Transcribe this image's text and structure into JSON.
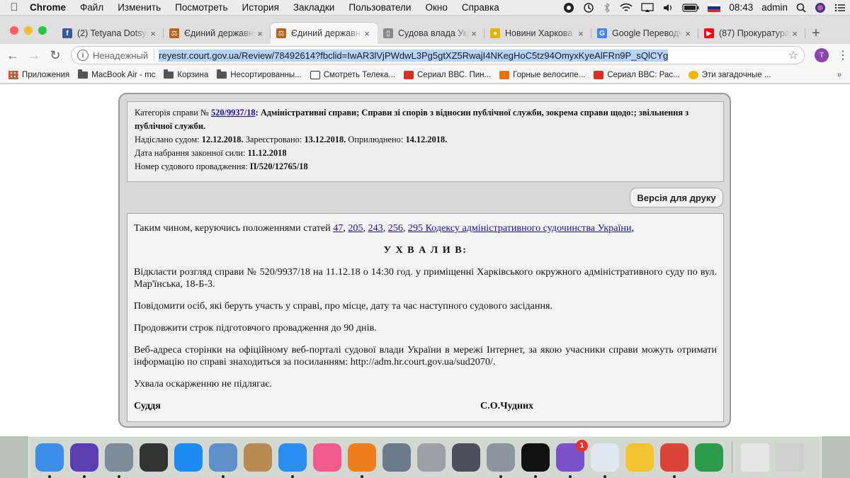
{
  "menubar": {
    "app": "Chrome",
    "items": [
      "Файл",
      "Изменить",
      "Посмотреть",
      "История",
      "Закладки",
      "Пользователи",
      "Окно",
      "Справка"
    ],
    "time": "08:43",
    "user": "admin"
  },
  "tabs": [
    {
      "title": "(2) Tetyana Dotsyak",
      "icon": "facebook-icon",
      "color": "#3b5998",
      "glyph": "f"
    },
    {
      "title": "Єдиний державний",
      "icon": "gavel-icon",
      "color": "#b5651d",
      "glyph": "⚖"
    },
    {
      "title": "Єдиний державний",
      "icon": "gavel-icon",
      "color": "#b5651d",
      "glyph": "⚖",
      "active": true
    },
    {
      "title": "Судова влада України",
      "icon": "page-icon",
      "color": "#888888",
      "glyph": "▯"
    },
    {
      "title": "Новини Харкова",
      "icon": "news-icon",
      "color": "#e8b400",
      "glyph": "●"
    },
    {
      "title": "Google Переводчик",
      "icon": "translate-icon",
      "color": "#4285f4",
      "glyph": "G"
    },
    {
      "title": "(87) Прокуратура",
      "icon": "youtube-icon",
      "color": "#ff0000",
      "glyph": "▶"
    }
  ],
  "toolbar": {
    "security": "Ненадежный",
    "url": "reyestr.court.gov.ua/Review/78492614?fbclid=IwAR3lVjPWdwL3Pg5gtXZ5RwajI4NKegHoC5tz94OmyxKyeAlFRn9P_sQlCYg",
    "profile_initial": "T"
  },
  "bookmarks": [
    {
      "label": "Приложения",
      "icon": "apps-grid-icon"
    },
    {
      "label": "MacBook Air - mc",
      "icon": "folder-icon"
    },
    {
      "label": "Корзина",
      "icon": "folder-icon"
    },
    {
      "label": "Несортированны...",
      "icon": "folder-icon"
    },
    {
      "label": "Смотреть Телека...",
      "icon": "tv-icon"
    },
    {
      "label": "Сериал ВВС. Пин...",
      "icon": "bookmark-red-icon"
    },
    {
      "label": "Горные велосипе...",
      "icon": "bookmark-orange-icon"
    },
    {
      "label": "Сериал ВВС: Рас...",
      "icon": "bookmark-red-icon"
    },
    {
      "label": "Эти загадочные ...",
      "icon": "bookmark-yellow-icon"
    }
  ],
  "meta": {
    "category_label": "Категорія справи №",
    "case_no": "520/9937/18",
    "category_text": ": Адміністративні справи; Справи зі спорів з відносин публічної служби, зокрема справи щодо:; звільнення з публічної служби.",
    "sent_label": "Надіслано судом:",
    "sent": "12.12.2018.",
    "reg_label": "Зареєстровано:",
    "reg": "13.12.2018.",
    "pub_label": "Оприлюднено:",
    "pub": "14.12.2018.",
    "force_label": "Дата набрання законної сили:",
    "force": "11.12.2018",
    "proc_label": "Номер судового провадження:",
    "proc": "П/520/12765/18"
  },
  "print_button": "Версія для друку",
  "doc": {
    "intro": "Таким чином, керуючись положеннями статей",
    "articles": [
      "47",
      "205",
      "243",
      "256"
    ],
    "code_link": "295 Кодексу адміністративного судочинства України",
    "resolved": "У Х В А Л И В:",
    "p1": "Відкласти розгляд справи № 520/9937/18 на 11.12.18 о 14:30 год. у приміщенні Харківського окружного адміністративного суду по вул. Мар'їнська, 18-Б-3.",
    "p2": "Повідомити осіб, які беруть участь у справі, про місце, дату та час наступного судового засідання.",
    "p3": "Продовжити строк підготовчого провадження до 90 днів.",
    "p4": "Веб-адреса сторінки на офіційному веб-порталі судової влади України в мережі Інтернет, за якою учасники справи можуть отримати інформацію по справі знаходиться за посиланням: http://adm.hr.court.gov.ua/sud2070/.",
    "p5": "Ухвала оскарженню не підлягає.",
    "judge_label": "Суддя",
    "judge_name": "С.О.Чудних"
  },
  "dock": [
    {
      "name": "finder-icon",
      "color": "#3d8ee8"
    },
    {
      "name": "siri-icon",
      "color": "#5b3fb0"
    },
    {
      "name": "launchpad-icon",
      "color": "#7c8a99"
    },
    {
      "name": "photo-booth-icon",
      "color": "#333333"
    },
    {
      "name": "app-store-icon",
      "color": "#1d8cf2"
    },
    {
      "name": "preview-icon",
      "color": "#5e8fc9"
    },
    {
      "name": "contacts-icon",
      "color": "#b88b52"
    },
    {
      "name": "safari-icon",
      "color": "#2a8ef0"
    },
    {
      "name": "itunes-icon",
      "color": "#f05a8c"
    },
    {
      "name": "ibooks-icon",
      "color": "#ef7d1a"
    },
    {
      "name": "keynote-icon",
      "color": "#6b7a8a"
    },
    {
      "name": "parental-controls-icon",
      "color": "#9aa0a6"
    },
    {
      "name": "script-editor-icon",
      "color": "#4a4f5a"
    },
    {
      "name": "disk-utility-icon",
      "color": "#8d969e"
    },
    {
      "name": "podcasts-icon",
      "color": "#111111"
    },
    {
      "name": "viber-icon",
      "color": "#7b51c9",
      "badge": "1"
    },
    {
      "name": "preview-docs-icon",
      "color": "#dfe7ef"
    },
    {
      "name": "photos-icon",
      "color": "#f4c430"
    },
    {
      "name": "chrome-icon",
      "color": "#db4437"
    },
    {
      "name": "grapher-icon",
      "color": "#2c9c4a"
    }
  ],
  "dock_right": [
    {
      "name": "document-icon",
      "color": "#e6e6e6"
    },
    {
      "name": "trash-icon",
      "color": "#cfcfcf"
    }
  ]
}
